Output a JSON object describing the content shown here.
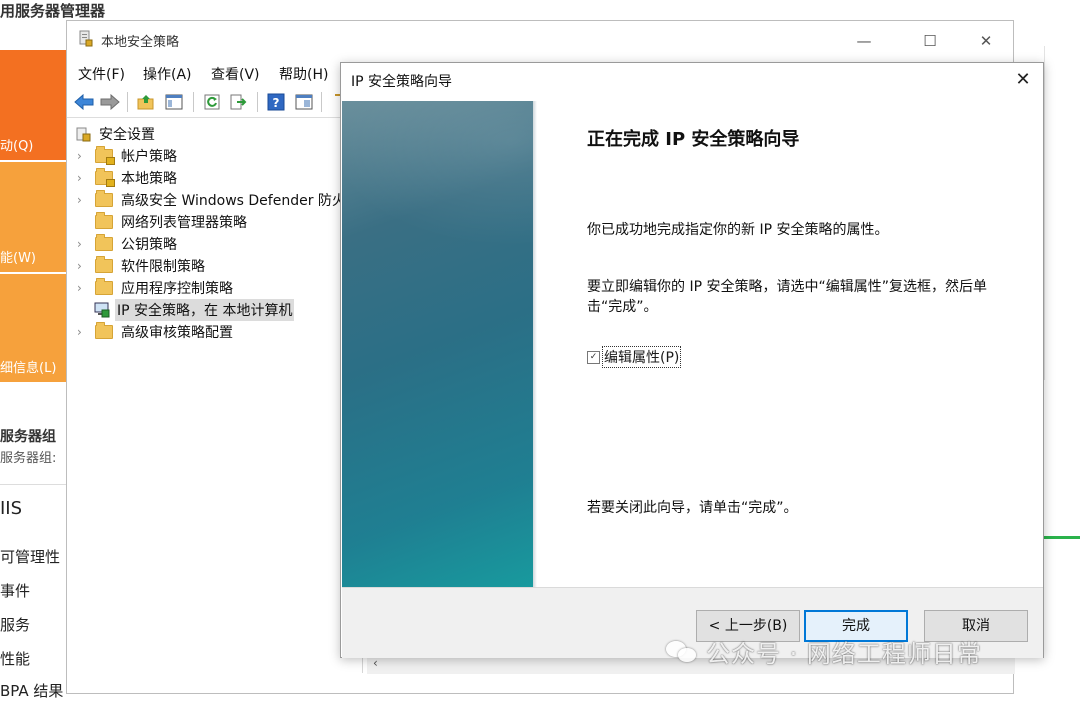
{
  "server_manager": {
    "title": "用服务器管理器",
    "left_blocks": [
      "动(Q)",
      "能(W)",
      "细信息(L)"
    ],
    "group_title": "服务器组",
    "group_sub": "服务器组:",
    "iis_label": "IIS",
    "items": [
      "可管理性",
      "事件",
      "服务",
      "性能",
      "BPA 结果"
    ],
    "colors": {
      "orange_dark": "#f37021",
      "orange_light": "#f6a13c",
      "green": "#2ab24b"
    }
  },
  "lsp": {
    "title": "本地安全策略",
    "menu": [
      "文件(F)",
      "操作(A)",
      "查看(V)",
      "帮助(H)"
    ],
    "toolbar_icons": [
      "back-arrow-icon",
      "forward-arrow-icon",
      "up-folder-icon",
      "show-tree-icon",
      "refresh-icon",
      "export-list-icon",
      "help-icon",
      "properties-icon"
    ],
    "tree": {
      "root": "安全设置",
      "items": [
        {
          "label": "帐户策略",
          "icon": "folder-lock-icon"
        },
        {
          "label": "本地策略",
          "icon": "folder-lock-icon"
        },
        {
          "label": "高级安全 Windows Defender 防火",
          "icon": "folder-icon"
        },
        {
          "label": "网络列表管理器策略",
          "icon": "folder-icon"
        },
        {
          "label": "公钥策略",
          "icon": "folder-icon"
        },
        {
          "label": "软件限制策略",
          "icon": "folder-icon"
        },
        {
          "label": "应用程序控制策略",
          "icon": "folder-icon"
        },
        {
          "label": "IP 安全策略，在 本地计算机",
          "icon": "ip-security-icon",
          "selected": true
        },
        {
          "label": "高级审核策略配置",
          "icon": "folder-icon"
        }
      ]
    }
  },
  "wizard": {
    "title": "IP 安全策略向导",
    "heading": "正在完成 IP 安全策略向导",
    "p1": "你已成功地完成指定你的新 IP 安全策略的属性。",
    "p2": "要立即编辑你的 IP 安全策略，请选中“编辑属性”复选框，然后单击“完成”。",
    "checkbox_label": "编辑属性(P)",
    "checkbox_checked": true,
    "p3": "若要关闭此向导，请单击“完成”。",
    "buttons": {
      "back": "< 上一步(B)",
      "finish": "完成",
      "cancel": "取消"
    },
    "accent_color": "#0078d7"
  },
  "watermark": "公众号 · 网络工程师日常"
}
